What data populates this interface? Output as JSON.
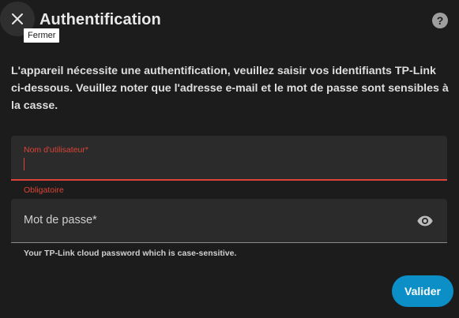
{
  "dialog": {
    "title": "Authentification",
    "close_tooltip": "Fermer",
    "description": "L'appareil nécessite une authentification, veuillez saisir vos identifiants TP-Link ci-dessous. Veuillez noter que l'adresse e-mail et le mot de passe sont sensibles à la casse."
  },
  "username": {
    "label": "Nom d'utilisateur*",
    "value": "",
    "error": "Obligatoire"
  },
  "password": {
    "label": "Mot de passe*",
    "helper": "Your TP-Link cloud password which is case-sensitive."
  },
  "actions": {
    "submit_label": "Valider"
  },
  "icons": {
    "close": "close-icon",
    "help": "help-circle-icon",
    "visibility": "eye-icon"
  },
  "colors": {
    "background": "#1c1c1c",
    "field": "#2b2b2b",
    "error": "#db4437",
    "primary": "#0c8fc7"
  }
}
